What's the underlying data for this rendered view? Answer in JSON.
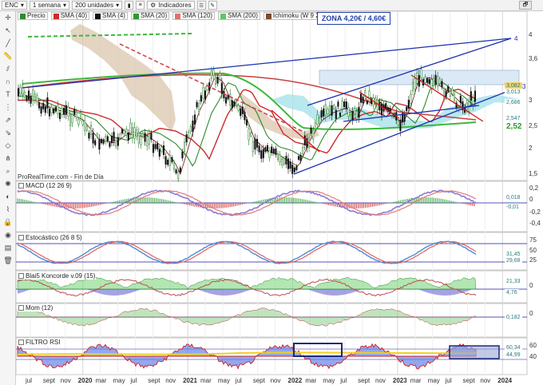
{
  "toolbar": {
    "symbol": "ENC",
    "period": "1 semana",
    "units": "200 unidades",
    "indicators": "Indicadores",
    "window_icon": "🗗"
  },
  "legend": [
    {
      "label": "Precio",
      "color": "#2d8a2d"
    },
    {
      "label": "SMA (40)",
      "color": "#cc2a2a"
    },
    {
      "label": "SMA (4)",
      "color": "#111111"
    },
    {
      "label": "SMA (20)",
      "color": "#2e9a2e"
    },
    {
      "label": "SMA (120)",
      "color": "#e07070"
    },
    {
      "label": "SMA (200)",
      "color": "#5ec85e"
    },
    {
      "label": "Ichimoku (W 9 26 52)",
      "color": "#7a4a2a"
    }
  ],
  "zone_label": "ZONA 4,20€ / 4,60€",
  "footnote": "ProRealTime.com - Fin de Día",
  "price_axis": [
    "4",
    "3,6",
    "3",
    "2,5",
    "2",
    "1,5"
  ],
  "price_tags": [
    {
      "text": "3,082",
      "bg": "#f3d36b"
    },
    {
      "text": "3,013",
      "bg": "#ffffff"
    },
    {
      "text": "2,686",
      "bg": "#ffffff"
    },
    {
      "text": "2,547",
      "bg": "#ffffff"
    },
    {
      "text": "2,52",
      "bg": "#ffffff"
    }
  ],
  "panels": {
    "macd": {
      "title": "MACD (12 26 9)",
      "axis": [
        "0,2",
        "0",
        "-0,2",
        "-0,4"
      ],
      "tags": [
        "0,018",
        "-0,01"
      ]
    },
    "stoch": {
      "title": "Estocástico (26 8 5)",
      "axis": [
        "75",
        "50",
        "25"
      ],
      "tags": [
        "31,45",
        "29,68"
      ]
    },
    "blai5": {
      "title": "Blai5 Koncorde v.09 (15)",
      "axis": [
        "0"
      ],
      "tags": [
        "21,33",
        "4,76"
      ]
    },
    "mom": {
      "title": "Mom (12)",
      "axis": [
        "0"
      ],
      "tags": [
        "0,182"
      ]
    },
    "rsi": {
      "title": "FILTRO RSI",
      "axis": [
        "60",
        "40"
      ],
      "tags": [
        "60,34",
        "44,99"
      ]
    }
  },
  "time_axis": [
    {
      "t": "jul",
      "b": false
    },
    {
      "t": "sept",
      "b": false
    },
    {
      "t": "nov",
      "b": false
    },
    {
      "t": "2020",
      "b": true
    },
    {
      "t": "mar",
      "b": false
    },
    {
      "t": "may",
      "b": false
    },
    {
      "t": "jul",
      "b": false
    },
    {
      "t": "sept",
      "b": false
    },
    {
      "t": "nov",
      "b": false
    },
    {
      "t": "2021",
      "b": true
    },
    {
      "t": "mar",
      "b": false
    },
    {
      "t": "may",
      "b": false
    },
    {
      "t": "jul",
      "b": false
    },
    {
      "t": "sept",
      "b": false
    },
    {
      "t": "nov",
      "b": false
    },
    {
      "t": "2022",
      "b": true
    },
    {
      "t": "mar",
      "b": false
    },
    {
      "t": "may",
      "b": false
    },
    {
      "t": "jul",
      "b": false
    },
    {
      "t": "sept",
      "b": false
    },
    {
      "t": "nov",
      "b": false
    },
    {
      "t": "2023",
      "b": true
    },
    {
      "t": "mar",
      "b": false
    },
    {
      "t": "may",
      "b": false
    },
    {
      "t": "jul",
      "b": false
    },
    {
      "t": "sept",
      "b": false
    },
    {
      "t": "nov",
      "b": false
    },
    {
      "t": "2024",
      "b": true
    }
  ],
  "trendline_labels": [
    "4",
    "3"
  ]
}
